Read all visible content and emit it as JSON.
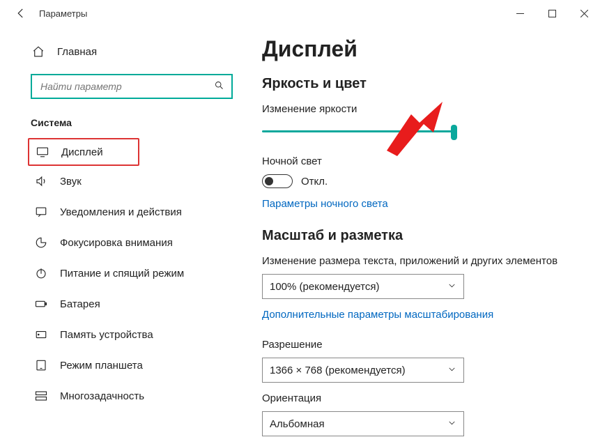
{
  "window": {
    "title": "Параметры"
  },
  "sidebar": {
    "home_label": "Главная",
    "search_placeholder": "Найти параметр",
    "section_title": "Система",
    "items": [
      {
        "label": "Дисплей"
      },
      {
        "label": "Звук"
      },
      {
        "label": "Уведомления и действия"
      },
      {
        "label": "Фокусировка внимания"
      },
      {
        "label": "Питание и спящий режим"
      },
      {
        "label": "Батарея"
      },
      {
        "label": "Память устройства"
      },
      {
        "label": "Режим планшета"
      },
      {
        "label": "Многозадачность"
      }
    ]
  },
  "main": {
    "page_title": "Дисплей",
    "brightness_section": "Яркость и цвет",
    "brightness_label": "Изменение яркости",
    "night_light_label": "Ночной свет",
    "night_light_state": "Откл.",
    "night_light_link": "Параметры ночного света",
    "scale_section": "Масштаб и разметка",
    "scale_desc": "Изменение размера текста, приложений и других элементов",
    "scale_value": "100% (рекомендуется)",
    "scale_link": "Дополнительные параметры масштабирования",
    "resolution_label": "Разрешение",
    "resolution_value": "1366 × 768 (рекомендуется)",
    "orientation_label": "Ориентация",
    "orientation_value": "Альбомная"
  }
}
